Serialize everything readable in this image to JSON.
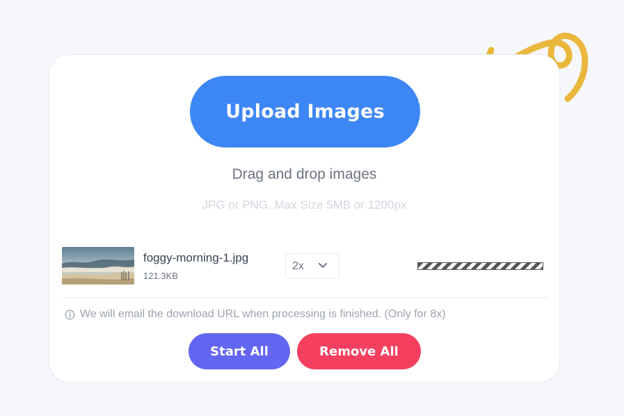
{
  "upload": {
    "button_label": "Upload Images",
    "drag_text": "Drag and drop images",
    "hint": "JPG or PNG. Max Size 5MB or 1200px"
  },
  "file": {
    "name": "foggy-morning-1.jpg",
    "size": "121.3KB",
    "scale": "2x",
    "progress": 1.0
  },
  "notice": "We will email the download URL when processing is finished. (Only for 8x)",
  "actions": {
    "start_all": "Start All",
    "remove_all": "Remove All"
  },
  "colors": {
    "background": "#f5f7fb",
    "upload_button": "#3d86f5",
    "start_button": "#6366f1",
    "remove_button": "#f43f5e",
    "arrow": "#eab73d"
  },
  "icons": {
    "notice": "info-circle-icon",
    "select": "chevron-down-icon",
    "decoration": "curly-arrow-icon"
  }
}
